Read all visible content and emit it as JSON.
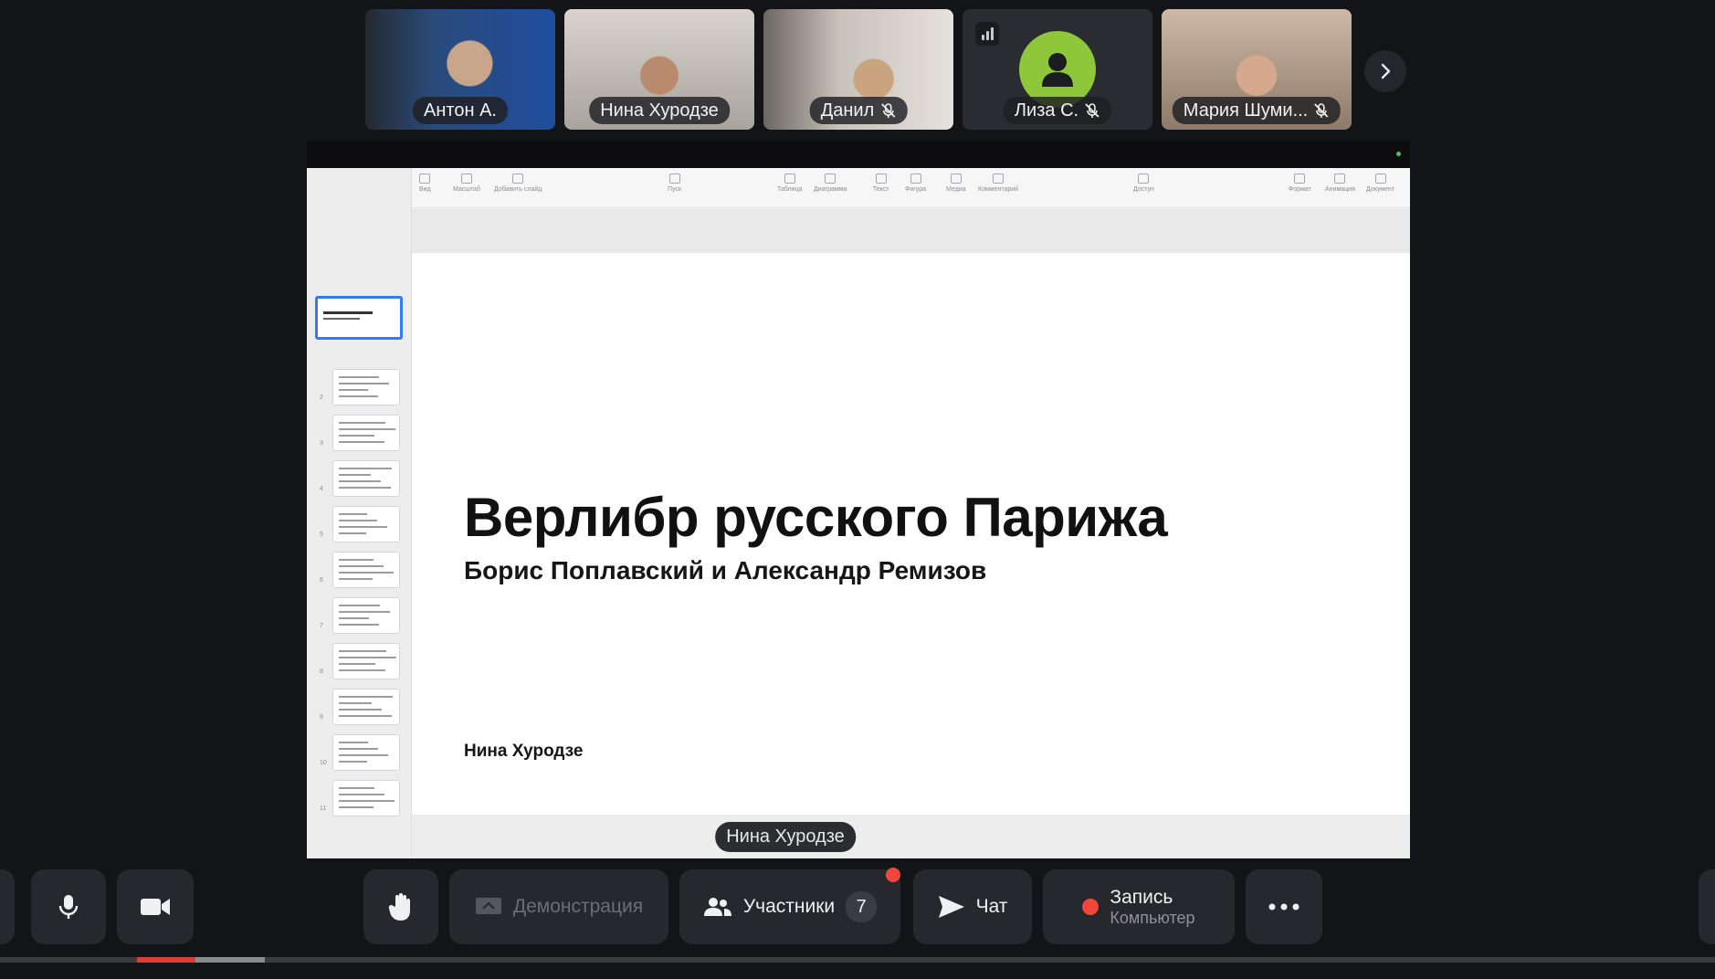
{
  "participants": [
    {
      "name": "Антон А.",
      "muted": false
    },
    {
      "name": "Нина Хуродзе",
      "muted": false
    },
    {
      "name": "Данил",
      "muted": true
    },
    {
      "name": "Лиза С.",
      "muted": true
    },
    {
      "name": "Мария Шуми...",
      "muted": true
    }
  ],
  "strip_next_icon": "chevron-right-icon",
  "presentation": {
    "title": "Верлибр русского Парижа",
    "subtitle": "Борис Поплавский и Александр Ремизов",
    "author": "Нина Хуродзе",
    "slide_count": 11,
    "current_slide": 1,
    "toolbar_tools": [
      "Вид",
      "Масштаб",
      "Добавить слайд",
      "Пуск",
      "Таблица",
      "Диаграмма",
      "Текст",
      "Фигура",
      "Медиа",
      "Комментарий",
      "Доступ",
      "Формат",
      "Анимация",
      "Документ"
    ]
  },
  "presenter_label": "Нина Хуродзе",
  "controls": {
    "screen_share_label": "Демонстрация",
    "participants_label": "Участники",
    "participants_count": "7",
    "chat_label": "Чат",
    "record_label": "Запись",
    "record_sub": "Компьютер"
  },
  "colors": {
    "accent_blue": "#2f7cf6",
    "record_red": "#f0463c",
    "avatar_green": "#8ec83a"
  },
  "playback": {
    "progress_percent": 3.4
  }
}
